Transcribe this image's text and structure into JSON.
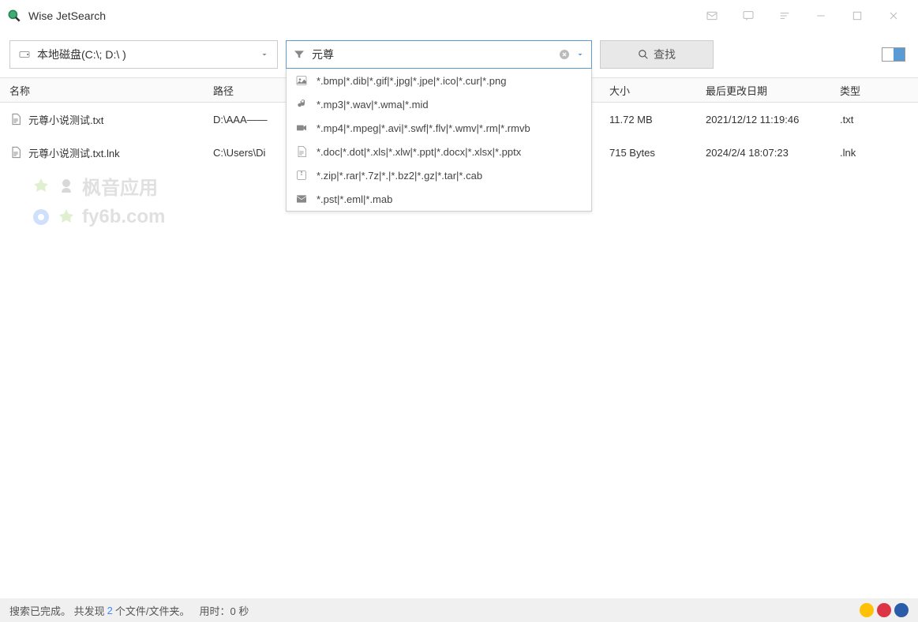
{
  "app": {
    "title": "Wise JetSearch"
  },
  "toolbar": {
    "drive_label": "本地磁盘(C:\\; D:\\ )",
    "search_value": "元尊",
    "search_button": "查找"
  },
  "filter_dropdown": {
    "items": [
      {
        "icon": "image",
        "text": "*.bmp|*.dib|*.gif|*.jpg|*.jpe|*.ico|*.cur|*.png"
      },
      {
        "icon": "music",
        "text": "*.mp3|*.wav|*.wma|*.mid"
      },
      {
        "icon": "video",
        "text": "*.mp4|*.mpeg|*.avi|*.swf|*.flv|*.wmv|*.rm|*.rmvb"
      },
      {
        "icon": "document",
        "text": "*.doc|*.dot|*.xls|*.xlw|*.ppt|*.docx|*.xlsx|*.pptx"
      },
      {
        "icon": "archive",
        "text": "*.zip|*.rar|*.7z|*.|*.bz2|*.gz|*.tar|*.cab"
      },
      {
        "icon": "mail",
        "text": "*.pst|*.eml|*.mab"
      }
    ]
  },
  "columns": {
    "name": "名称",
    "path": "路径",
    "size": "大小",
    "date": "最后更改日期",
    "type": "类型"
  },
  "results": [
    {
      "name": "元尊小说测试.txt",
      "path": "D:\\AAA——",
      "size": "11.72 MB",
      "date": "2021/12/12 11:19:46",
      "type": ".txt"
    },
    {
      "name": "元尊小说测试.txt.lnk",
      "path": "C:\\Users\\Di",
      "size": "715 Bytes",
      "date": "2024/2/4 18:07:23",
      "type": ".lnk"
    }
  ],
  "watermark": {
    "line1": "枫音应用",
    "line2": "fy6b.com"
  },
  "status": {
    "prefix": "搜索已完成。 共发现",
    "count": "2",
    "mid": "个文件/文件夹。",
    "time_label": "用时：",
    "time_value": "0 秒"
  }
}
